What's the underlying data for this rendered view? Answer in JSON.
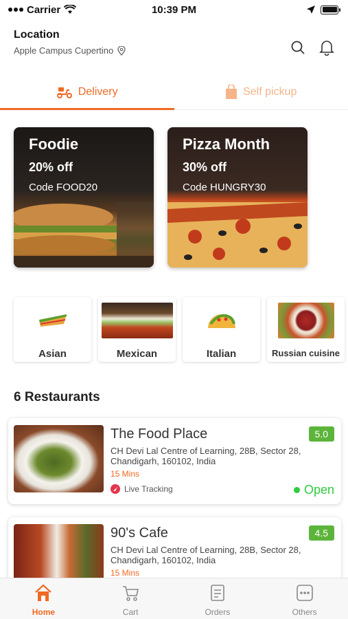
{
  "status_bar": {
    "carrier": "Carrier",
    "time": "10:39 PM"
  },
  "header": {
    "title": "Location",
    "subtitle": "Apple Campus Cupertino"
  },
  "tabs": [
    {
      "label": "Delivery",
      "icon": "scooter-icon",
      "active": true
    },
    {
      "label": "Self pickup",
      "icon": "shopping-bag-icon",
      "active": false
    }
  ],
  "promos": [
    {
      "title": "Foodie",
      "discount": "20% off",
      "code": "Code FOOD20"
    },
    {
      "title": "Pizza Month",
      "discount": "30% off",
      "code": "Code HUNGRY30"
    }
  ],
  "categories": [
    {
      "label": "Asian"
    },
    {
      "label": "Mexican"
    },
    {
      "label": "Italian"
    },
    {
      "label": "Russian cuisine"
    }
  ],
  "restaurants_heading": "6 Restaurants",
  "restaurants": [
    {
      "name": "The Food Place",
      "rating": "5.0",
      "address": "CH Devi Lal Centre of Learning, 28B, Sector 28, Chandigarh, 160102, India",
      "time": "15  Mins",
      "tracking": "Live Tracking",
      "status": "Open"
    },
    {
      "name": "90's Cafe",
      "rating": "4.5",
      "address": "CH Devi Lal Centre of Learning, 28B, Sector 28, Chandigarh, 160102, India",
      "time": "15  Mins"
    }
  ],
  "nav": [
    {
      "label": "Home",
      "icon": "home-icon",
      "active": true
    },
    {
      "label": "Cart",
      "icon": "cart-icon",
      "active": false
    },
    {
      "label": "Orders",
      "icon": "orders-icon",
      "active": false
    },
    {
      "label": "Others",
      "icon": "more-icon",
      "active": false
    }
  ],
  "colors": {
    "accent": "#ef6a24",
    "rating": "#5cb53a",
    "open": "#2ecc40"
  }
}
